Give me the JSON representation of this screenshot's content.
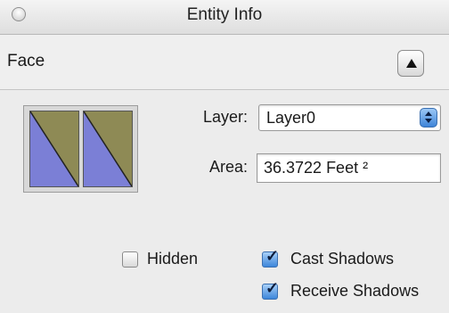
{
  "window": {
    "title": "Entity Info"
  },
  "header": {
    "entity_type": "Face"
  },
  "materials": {
    "front_swatch": {
      "primary_color": "#8e8a55",
      "secondary_color": "#7b7fd6"
    },
    "back_swatch": {
      "primary_color": "#8e8a55",
      "secondary_color": "#7b7fd6"
    }
  },
  "fields": {
    "layer_label": "Layer:",
    "layer_value": "Layer0",
    "area_label": "Area:",
    "area_value": "36.3722 Feet ²"
  },
  "options": {
    "hidden": {
      "label": "Hidden",
      "checked": false
    },
    "cast_shadows": {
      "label": "Cast Shadows",
      "checked": true
    },
    "receive_shadows": {
      "label": "Receive Shadows",
      "checked": true
    }
  },
  "colors": {
    "accent": "#3d86da",
    "panel": "#ececec"
  }
}
